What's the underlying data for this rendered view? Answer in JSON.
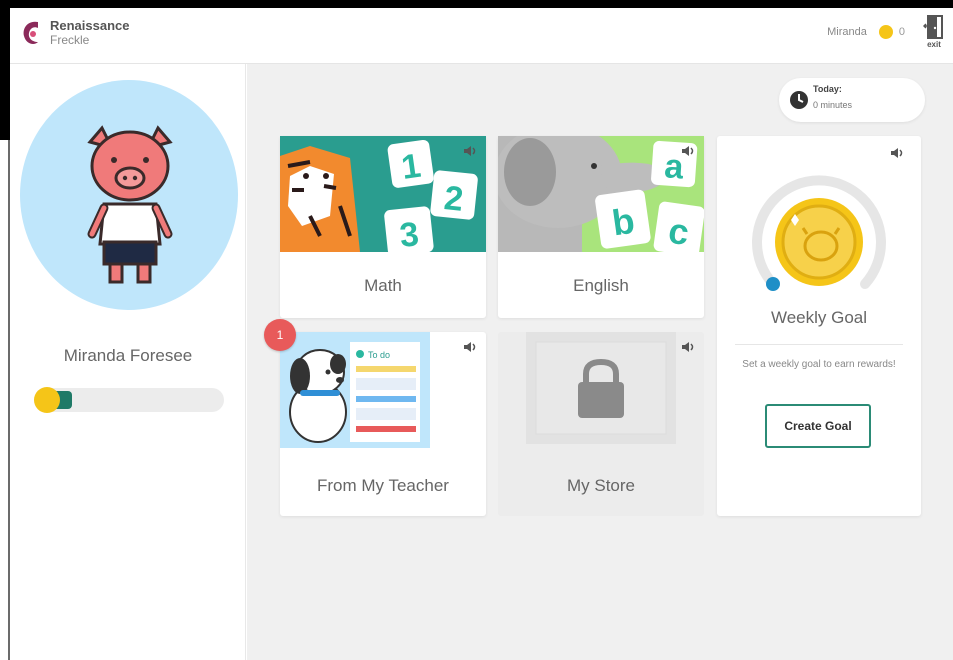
{
  "brand": {
    "name": "Renaissance",
    "product": "Freckle"
  },
  "user": {
    "name": "Miranda",
    "coins": "0"
  },
  "exit_label": "exit",
  "profile": {
    "full_name": "Miranda Foresee",
    "progress_fraction": 0.14
  },
  "timer": {
    "label": "Today:",
    "value": "0 minutes"
  },
  "cards": {
    "math": {
      "label": "Math"
    },
    "english": {
      "label": "English"
    },
    "teacher": {
      "label": "From My Teacher",
      "badge": "1"
    },
    "store": {
      "label": "My Store"
    }
  },
  "teacher_art": {
    "todo": "To do"
  },
  "weekly_goal": {
    "title": "Weekly Goal",
    "description": "Set a weekly goal to earn rewards!",
    "button_label": "Create Goal"
  },
  "colors": {
    "accent_green": "#1f7a67",
    "math_bg": "#2a9d8f",
    "coin_gold": "#f5c518",
    "avatar_bg": "#bfe6fb",
    "badge_red": "#e85a5a"
  },
  "icons": [
    "freckle-logo-icon",
    "coin-icon",
    "exit-door-icon",
    "clock-icon",
    "speaker-icon",
    "lock-icon"
  ]
}
